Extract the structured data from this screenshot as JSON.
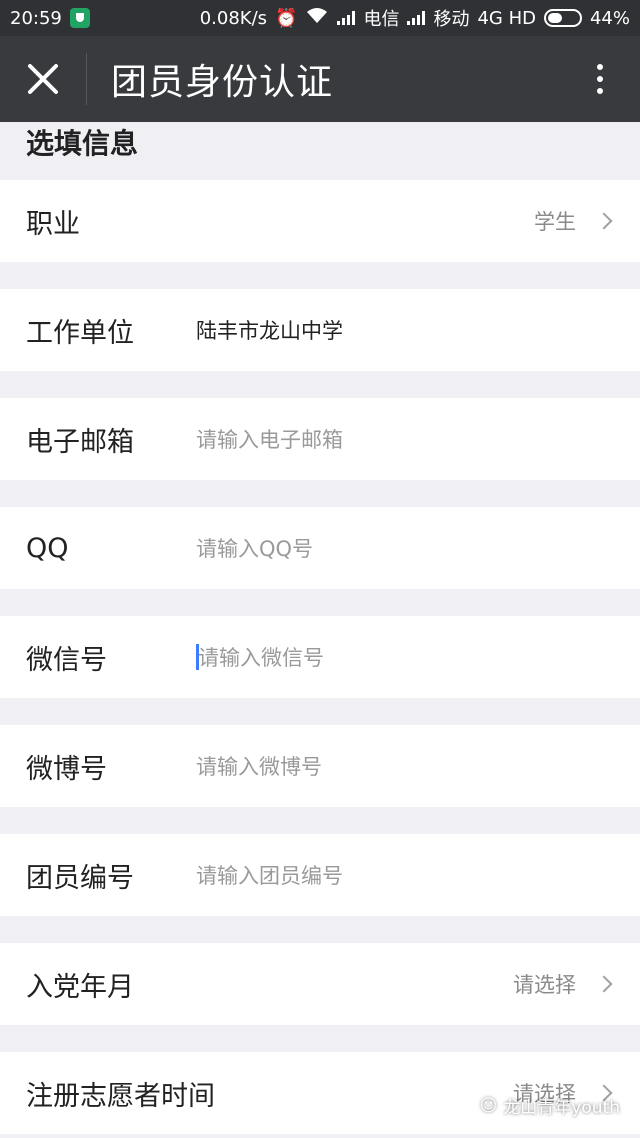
{
  "status_bar": {
    "time": "20:59",
    "speed": "0.08K/s",
    "carrier1": "电信",
    "carrier2": "移动",
    "network": "4G HD",
    "battery": "44%"
  },
  "header": {
    "title": "团员身份认证",
    "close_icon": "close-icon",
    "more_icon": "more-vertical-icon"
  },
  "section": {
    "title": "选填信息"
  },
  "fields": {
    "occupation": {
      "label": "职业",
      "value": "学生"
    },
    "work_unit": {
      "label": "工作单位",
      "value": "陆丰市龙山中学"
    },
    "email": {
      "label": "电子邮箱",
      "placeholder": "请输入电子邮箱"
    },
    "qq": {
      "label": "QQ",
      "placeholder": "请输入QQ号"
    },
    "wechat": {
      "label": "微信号",
      "placeholder": "请输入微信号"
    },
    "weibo": {
      "label": "微博号",
      "placeholder": "请输入微博号"
    },
    "member_no": {
      "label": "团员编号",
      "placeholder": "请输入团员编号"
    },
    "party_date": {
      "label": "入党年月",
      "value": "请选择"
    },
    "volunteer_time": {
      "label": "注册志愿者时间",
      "value": "请选择"
    }
  },
  "watermark": "龙山青年youth",
  "colors": {
    "statusbar_bg": "#2f3135",
    "titlebar_bg": "#383a3e",
    "page_bg": "#efeff4",
    "cursor": "#3d7bff"
  }
}
